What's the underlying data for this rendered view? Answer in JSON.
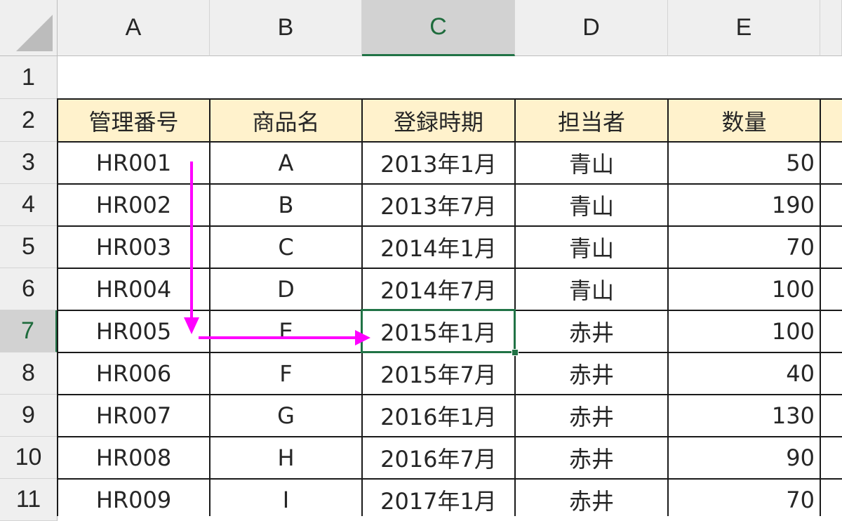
{
  "grid": {
    "column_headers": [
      "A",
      "B",
      "C",
      "D",
      "E"
    ],
    "row_headers": [
      "1",
      "2",
      "3",
      "4",
      "5",
      "6",
      "7",
      "8",
      "9",
      "10",
      "11"
    ],
    "selected_column": "C",
    "selected_row": "7",
    "active_cell": "C7"
  },
  "table": {
    "headers": [
      "管理番号",
      "商品名",
      "登録時期",
      "担当者",
      "数量"
    ],
    "rows": [
      [
        "HR001",
        "A",
        "2013年1月",
        "青山",
        "50"
      ],
      [
        "HR002",
        "B",
        "2013年7月",
        "青山",
        "190"
      ],
      [
        "HR003",
        "C",
        "2014年1月",
        "青山",
        "70"
      ],
      [
        "HR004",
        "D",
        "2014年7月",
        "青山",
        "100"
      ],
      [
        "HR005",
        "E",
        "2015年1月",
        "赤井",
        "100"
      ],
      [
        "HR006",
        "F",
        "2015年7月",
        "赤井",
        "40"
      ],
      [
        "HR007",
        "G",
        "2016年1月",
        "赤井",
        "130"
      ],
      [
        "HR008",
        "H",
        "2016年7月",
        "赤井",
        "90"
      ],
      [
        "HR009",
        "I",
        "2017年1月",
        "赤井",
        "70"
      ]
    ]
  },
  "annotation": {
    "description_icon": "lookup-path-arrows",
    "color": "#ff00ff"
  },
  "colors": {
    "header_fill": "#fff2cc",
    "selection": "#217346",
    "header_background": "#efefef"
  }
}
